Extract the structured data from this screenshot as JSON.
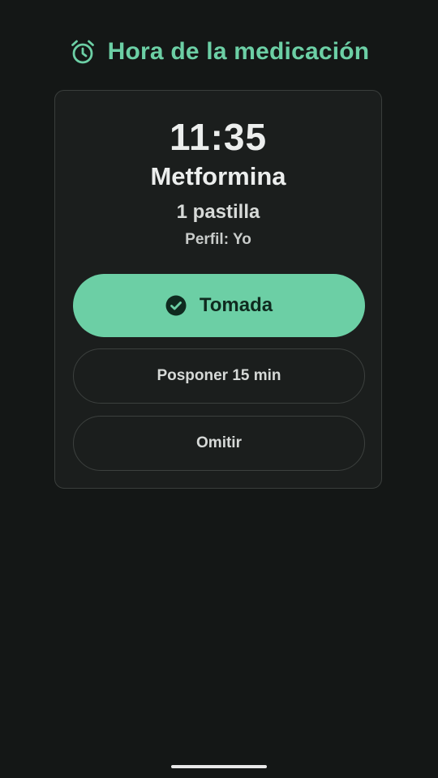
{
  "header": {
    "icon": "alarm-clock-icon",
    "title": "Hora de la medicación"
  },
  "reminder": {
    "time": "11:35",
    "medication": "Metformina",
    "dose": "1 pastilla",
    "profile": "Perfil: Yo"
  },
  "actions": {
    "taken_icon": "check-circle-icon",
    "taken_label": "Tomada",
    "snooze_label": "Posponer 15 min",
    "skip_label": "Omitir"
  },
  "colors": {
    "background": "#141716",
    "card": "#1b1e1d",
    "accent": "#6ccfa5",
    "accent_text": "#0f2a1f"
  }
}
